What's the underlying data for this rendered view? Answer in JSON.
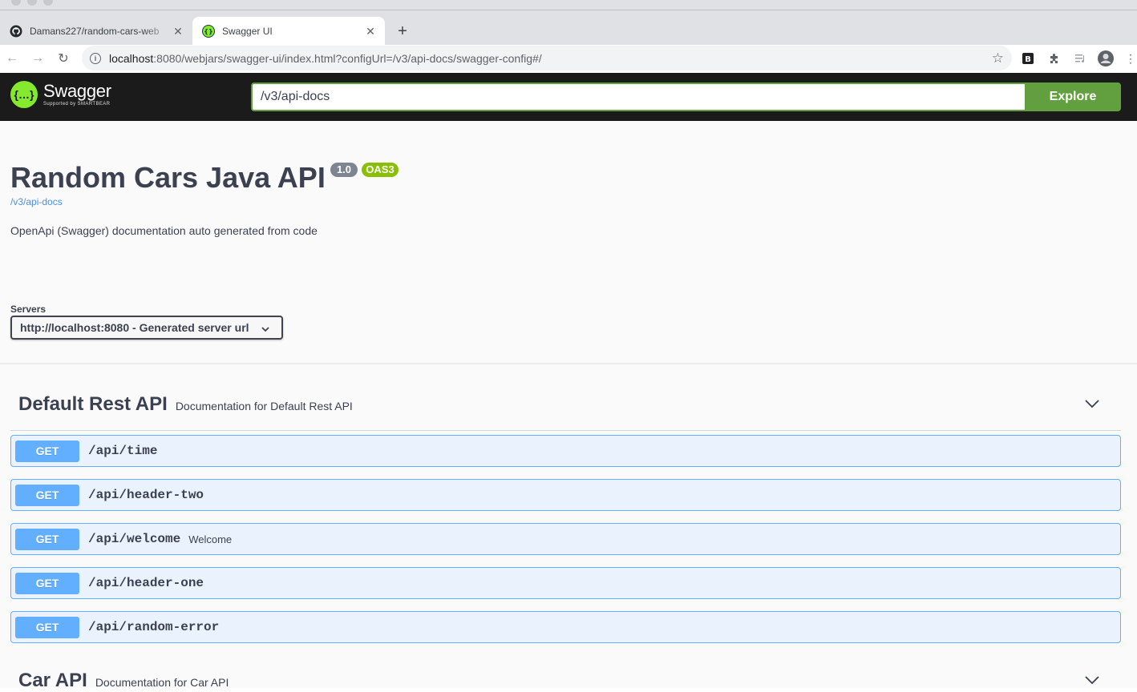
{
  "browser": {
    "tabs": [
      {
        "title": "Damans227/random-cars-web",
        "icon": "github-icon"
      },
      {
        "title": "Swagger UI",
        "icon": "swagger-icon"
      }
    ],
    "new_tab": "+",
    "close": "✕",
    "url_host": "localhost",
    "url_rest": ":8080/webjars/swagger-ui/index.html?configUrl=/v3/api-docs/swagger-config#/"
  },
  "swagger": {
    "brand": "Swagger",
    "brand_sub": "Supported by SMARTBEAR",
    "logo_glyph": "{…}",
    "url_value": "/v3/api-docs",
    "explore_label": "Explore"
  },
  "info": {
    "title": "Random Cars Java API",
    "version": "1.0",
    "oas": "OAS3",
    "spec_url": "/v3/api-docs",
    "description": "OpenApi (Swagger) documentation auto generated from code"
  },
  "servers": {
    "label": "Servers",
    "selected": "http://localhost:8080 - Generated server url"
  },
  "tags": [
    {
      "name": "Default Rest API",
      "description": "Documentation for Default Rest API",
      "operations": [
        {
          "method": "GET",
          "path": "/api/time",
          "summary": ""
        },
        {
          "method": "GET",
          "path": "/api/header-two",
          "summary": ""
        },
        {
          "method": "GET",
          "path": "/api/welcome",
          "summary": "Welcome"
        },
        {
          "method": "GET",
          "path": "/api/header-one",
          "summary": ""
        },
        {
          "method": "GET",
          "path": "/api/random-error",
          "summary": ""
        }
      ]
    },
    {
      "name": "Car API",
      "description": "Documentation for Car API",
      "operations": []
    }
  ],
  "colors": {
    "get": "#61affe",
    "topbar": "#1b1b1b",
    "explore": "#62a03f",
    "oas": "#89bf04"
  }
}
